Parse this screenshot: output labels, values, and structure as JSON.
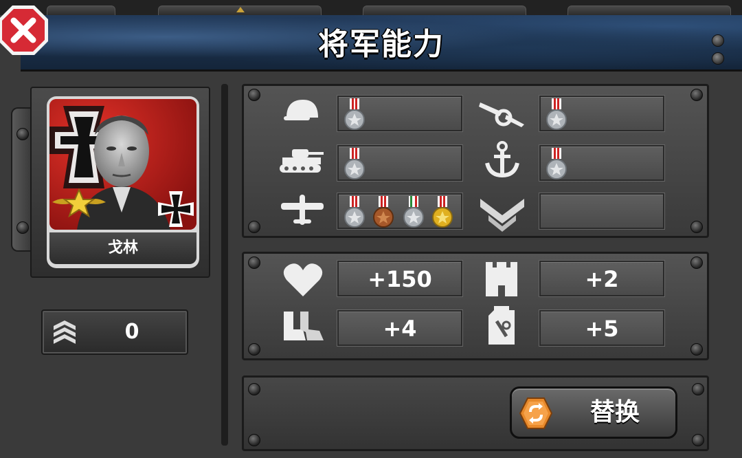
{
  "header": {
    "title": "将军能力"
  },
  "general": {
    "name": "戈林",
    "rank_value": "0"
  },
  "skills": {
    "rows": [
      {
        "left_icon": "infantry-helmet-icon",
        "left_medals": [
          "silver"
        ],
        "right_icon": "artillery-cannon-icon",
        "right_medals": [
          "silver"
        ]
      },
      {
        "left_icon": "tank-icon",
        "left_medals": [
          "silver"
        ],
        "right_icon": "navy-anchor-icon",
        "right_medals": [
          "silver"
        ]
      },
      {
        "left_icon": "airplane-icon",
        "left_medals": [
          "silver",
          "bronze",
          "silver",
          "gold"
        ],
        "right_icon": "rank-wings-icon",
        "right_medals": []
      }
    ]
  },
  "stats": {
    "health": "+150",
    "fortification": "+4",
    "movement": "+2",
    "fuel": "+5"
  },
  "actions": {
    "replace_label": "替换"
  },
  "colors": {
    "header_blue": "#223a5a",
    "close_red": "#d62a35",
    "panel_gray": "#4a4a4a",
    "replace_orange": "#e8892a"
  }
}
